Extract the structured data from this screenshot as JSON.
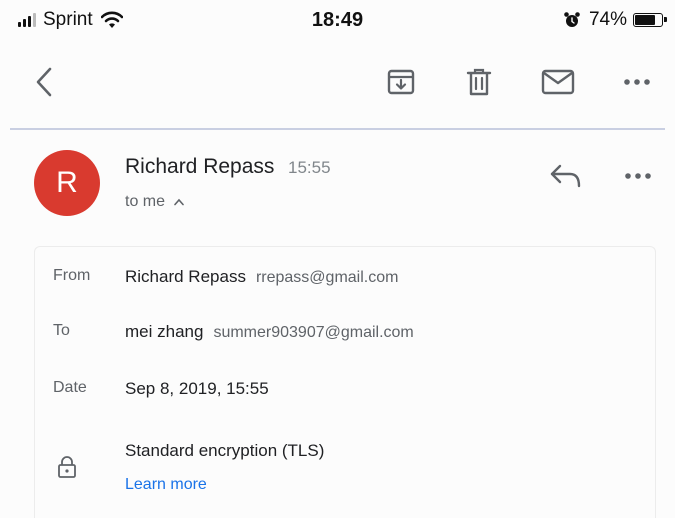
{
  "status_bar": {
    "carrier": "Sprint",
    "time": "18:49",
    "battery": "74%"
  },
  "toolbar": {
    "icons": [
      "back-icon",
      "archive-icon",
      "trash-icon",
      "mail-icon",
      "more-icon"
    ]
  },
  "message": {
    "avatar_letter": "R",
    "avatar_color": "#d93a2f",
    "sender_name": "Richard Repass",
    "time": "15:55",
    "recipient_summary": "to me"
  },
  "details": {
    "from_label": "From",
    "from_name": "Richard Repass",
    "from_email": "rrepass@gmail.com",
    "to_label": "To",
    "to_name": "mei zhang",
    "to_email": "summer903907@gmail.com",
    "date_label": "Date",
    "date_value": "Sep 8, 2019, 15:55",
    "encryption_text": "Standard encryption (TLS)",
    "learn_more": "Learn more"
  },
  "colors": {
    "accent_link": "#1a73e8",
    "divider": "#c9cfe2"
  }
}
